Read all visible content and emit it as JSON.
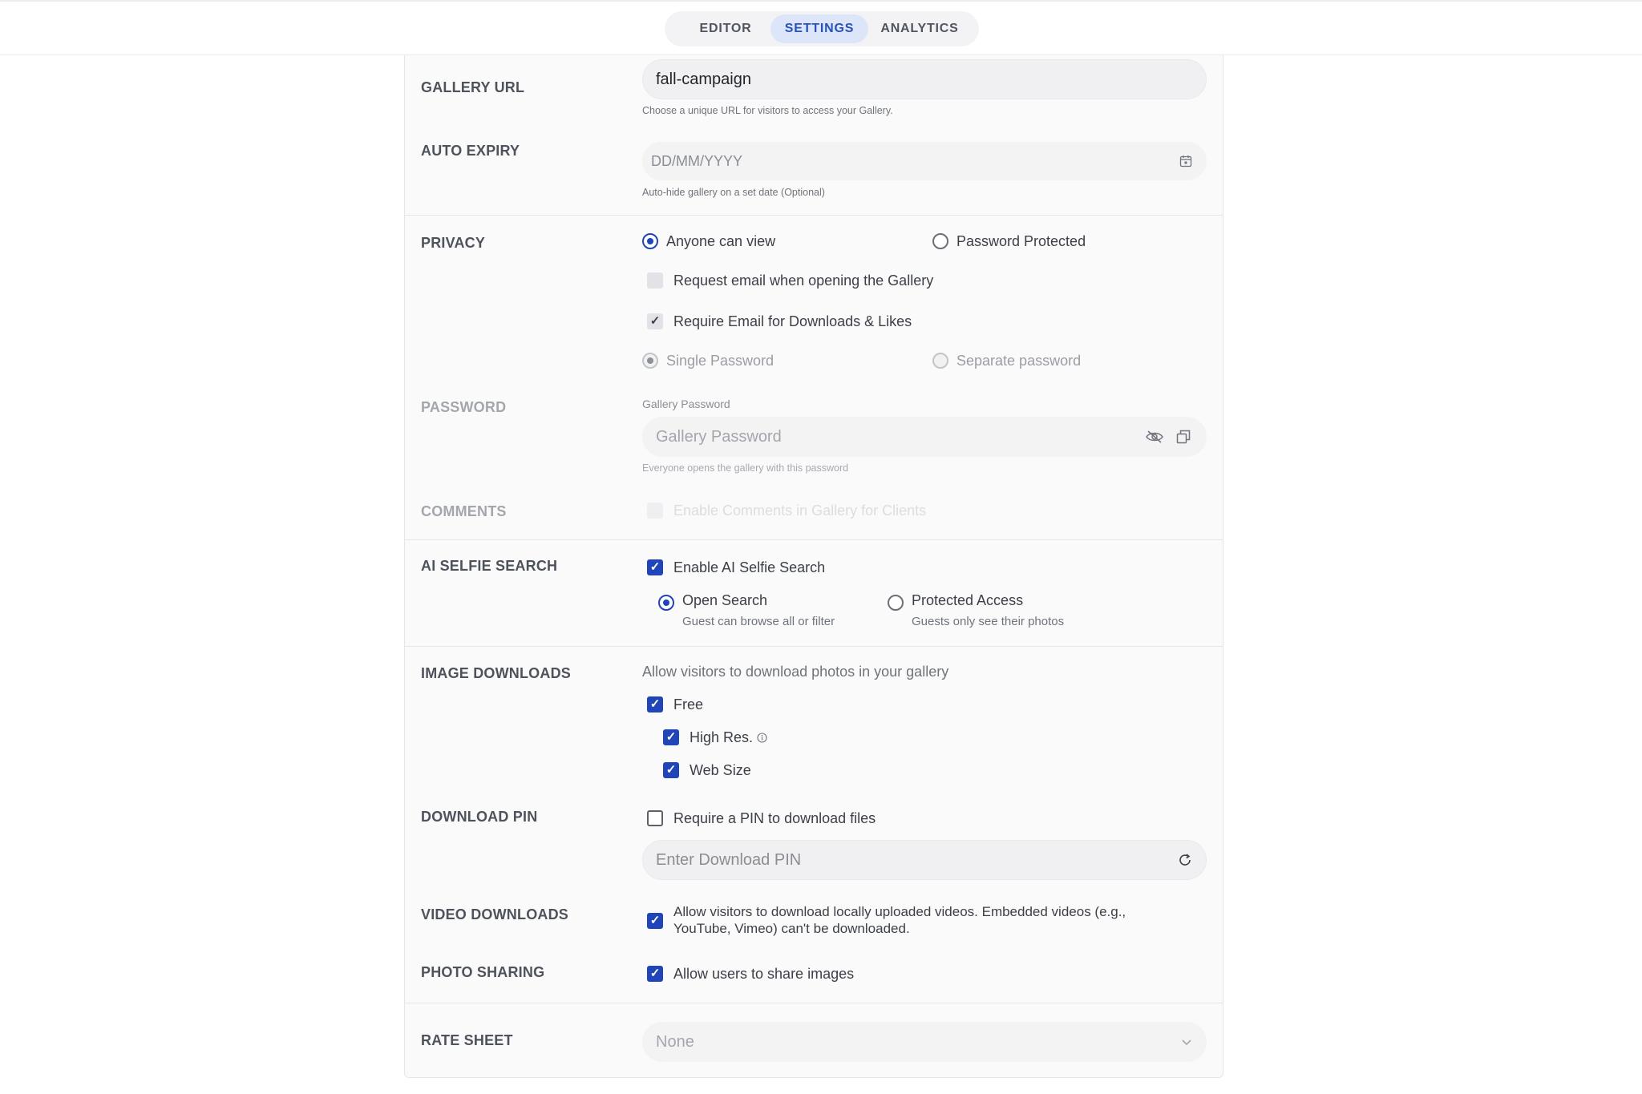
{
  "tabs": [
    {
      "label": "EDITOR"
    },
    {
      "label": "SETTINGS"
    },
    {
      "label": "ANALYTICS"
    }
  ],
  "gallery_url": {
    "label": "GALLERY URL",
    "value": "fall-campaign",
    "hint": "Choose a unique URL for visitors to access your Gallery."
  },
  "auto_expiry": {
    "label": "AUTO EXPIRY",
    "placeholder": "DD/MM/YYYY",
    "hint": "Auto-hide gallery on a set date (Optional)"
  },
  "privacy": {
    "label": "PRIVACY",
    "option_anyone": "Anyone can view",
    "option_password": "Password Protected",
    "request_email": "Request email when opening the Gallery",
    "require_email": "Require Email for Downloads & Likes",
    "single_password": "Single Password",
    "separate_password": "Separate password"
  },
  "password": {
    "label": "PASSWORD",
    "field_label": "Gallery Password",
    "placeholder": "Gallery Password",
    "hint": "Everyone opens the gallery with this password"
  },
  "comments": {
    "label": "COMMENTS",
    "option": "Enable Comments in Gallery for Clients"
  },
  "ai_selfie": {
    "label": "AI SELFIE SEARCH",
    "enable": "Enable AI Selfie Search",
    "open_title": "Open Search",
    "open_sub": "Guest can browse all or filter",
    "protected_title": "Protected Access",
    "protected_sub": "Guests only see their photos"
  },
  "image_downloads": {
    "label": "IMAGE DOWNLOADS",
    "description": "Allow visitors to download photos in your gallery",
    "free": "Free",
    "high_res": "High Res.",
    "web_size": "Web Size"
  },
  "download_pin": {
    "label": "DOWNLOAD PIN",
    "option": "Require a PIN to download files",
    "placeholder": "Enter Download PIN"
  },
  "video_downloads": {
    "label": "VIDEO DOWNLOADS",
    "line1": "Allow visitors to download locally uploaded videos. Embedded videos (e.g.,",
    "line2": "YouTube, Vimeo) can't be downloaded."
  },
  "photo_sharing": {
    "label": "PHOTO SHARING",
    "option": "Allow users to share images"
  },
  "rate_sheet": {
    "label": "RATE SHEET",
    "value": "None"
  },
  "icons": {
    "calendar": "calendar-icon",
    "eye_off": "eye-off-icon",
    "copy": "copy-icon",
    "info": "info-icon",
    "refresh": "refresh-icon",
    "chevron": "chevron-down-icon"
  },
  "colors": {
    "accent": "#2045b8",
    "active_tab_bg": "#dde6f8",
    "active_tab_text": "#2852b8"
  }
}
